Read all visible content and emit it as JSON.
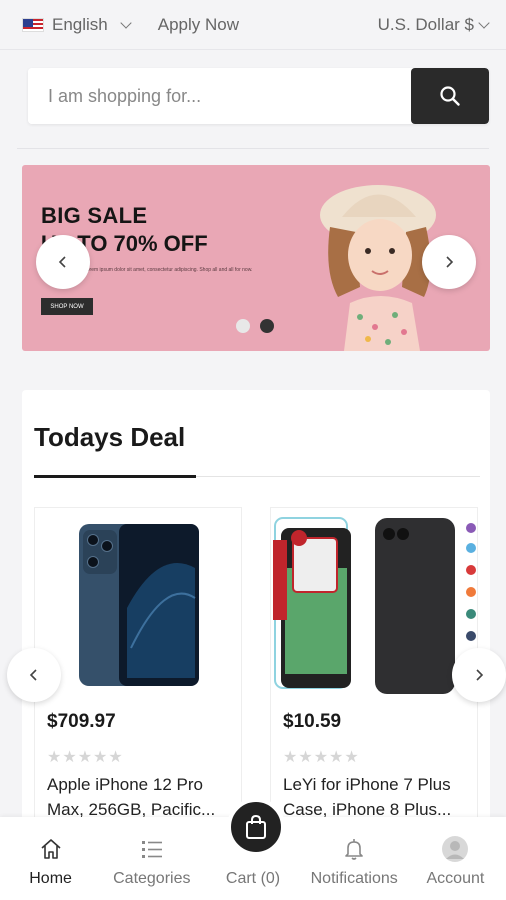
{
  "topbar": {
    "language": "English",
    "apply_now": "Apply Now",
    "currency": "U.S. Dollar $"
  },
  "search": {
    "placeholder": "I am shopping for..."
  },
  "banner": {
    "title": "BIG SALE",
    "subtitle": "UP TO 70% OFF",
    "small_text": "Lorem ipsum dolor sit amet, consectetur adipiscing. Shop all and all for now.",
    "cta": "SHOP NOW",
    "slide_index": 2,
    "slide_count": 2
  },
  "deals": {
    "title": "Todays Deal",
    "products": [
      {
        "price": "$709.97",
        "rating": 0,
        "name": "Apple iPhone 12 Pro Max, 256GB, Pacific..."
      },
      {
        "price": "$10.59",
        "rating": 0,
        "name": "LeYi for iPhone 7 Plus Case, iPhone 8 Plus..."
      }
    ]
  },
  "bottom_nav": {
    "home": "Home",
    "categories": "Categories",
    "cart": "Cart (0)",
    "notifications": "Notifications",
    "account": "Account"
  },
  "colors": {
    "accent_dark": "#222222",
    "banner_bg": "#e9a7b5",
    "page_bg": "#f4f4f6"
  }
}
